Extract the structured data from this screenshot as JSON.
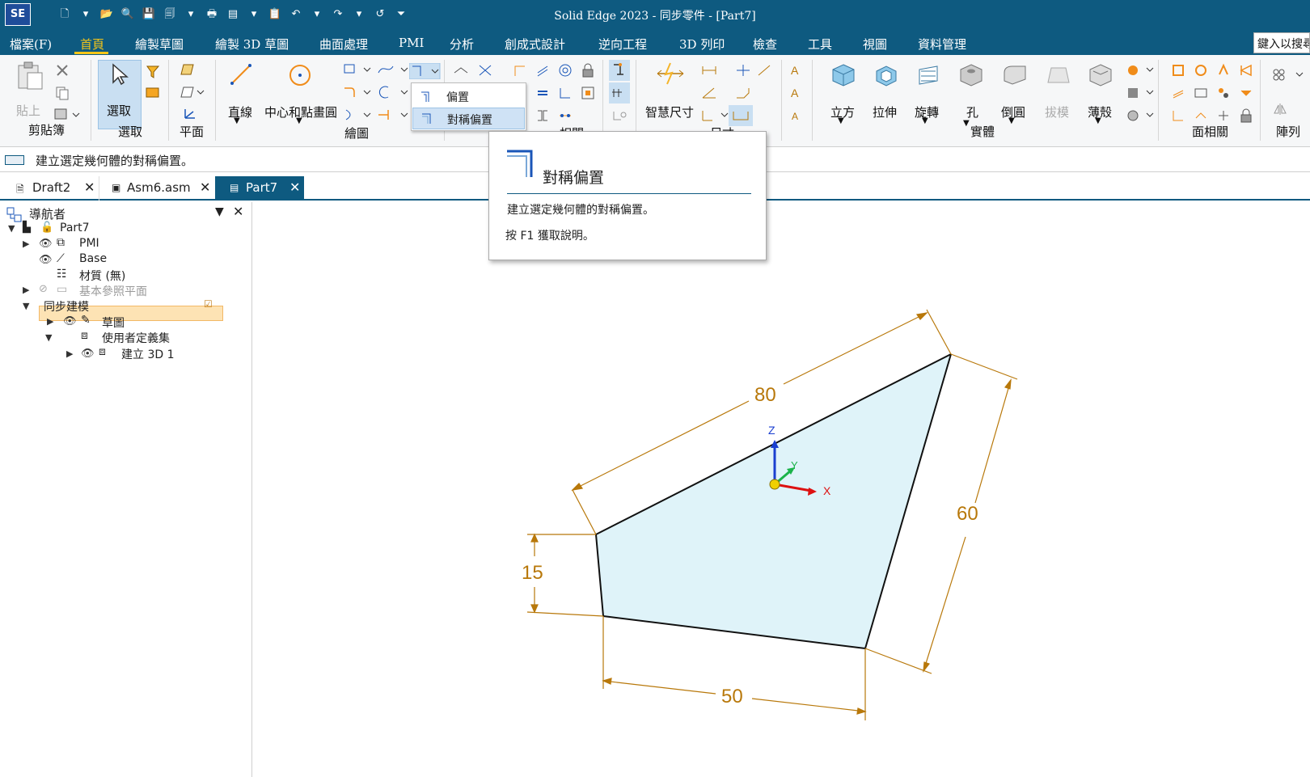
{
  "window": {
    "title": "Solid Edge 2023 - 同步零件 - [Part7]",
    "logo": "SE"
  },
  "menu": {
    "file": "檔案(F)",
    "tabs": [
      "首頁",
      "繪製草圖",
      "繪製 3D 草圖",
      "曲面處理",
      "PMI",
      "分析",
      "創成式設計",
      "逆向工程",
      "3D 列印",
      "檢查",
      "工具",
      "視圖",
      "資料管理"
    ],
    "active_tab": "首頁",
    "search_placeholder": "鍵入以搜尋"
  },
  "ribbon": {
    "paste": "貼上",
    "clipboard_group": "剪貼簿",
    "select": "選取",
    "select_group": "選取",
    "plane_group": "平面",
    "line": "直線",
    "circle": "中心和點畫圓",
    "draw_group": "繪圖",
    "relate_group": "相關",
    "smart_dimension": "智慧尺寸",
    "dimension_group": "尺寸",
    "extrude_box": "立方",
    "extrude": "拉伸",
    "revolve": "旋轉",
    "hole": "孔",
    "round": "倒圓",
    "draft": "拔模",
    "thin_wall": "薄殼",
    "solids_group": "實體",
    "face_related_group": "面相關",
    "pattern": "陣列"
  },
  "offset_dropdown": {
    "items": [
      "偏置",
      "對稱偏置"
    ],
    "highlighted": "對稱偏置"
  },
  "prompt_bar": {
    "text": "建立選定幾何體的對稱偏置。"
  },
  "document_tabs": [
    {
      "label": "Draft2",
      "active": false
    },
    {
      "label": "Asm6.asm",
      "active": false
    },
    {
      "label": "Part7",
      "active": true
    }
  ],
  "navigator": {
    "title": "導航者",
    "items": {
      "root": "Part7",
      "pmi": "PMI",
      "base": "Base",
      "material": "材質 (無)",
      "ref_planes": "基本參照平面",
      "sync_modeling": "同步建模",
      "sketch": "草圖",
      "user_sets": "使用者定義集",
      "create3d": "建立 3D 1"
    }
  },
  "tooltip": {
    "title": "對稱偏置",
    "description": "建立選定幾何體的對稱偏置。",
    "help": "按 F1 獲取說明。"
  },
  "sketch": {
    "dimensions": {
      "top": "80",
      "right": "60",
      "left": "15",
      "bottom": "50"
    },
    "axes": {
      "x": "X",
      "y": "Y",
      "z": "Z"
    },
    "colors": {
      "fill": "#dff3f9",
      "dimension": "#b8780a",
      "edge": "#111111"
    }
  }
}
